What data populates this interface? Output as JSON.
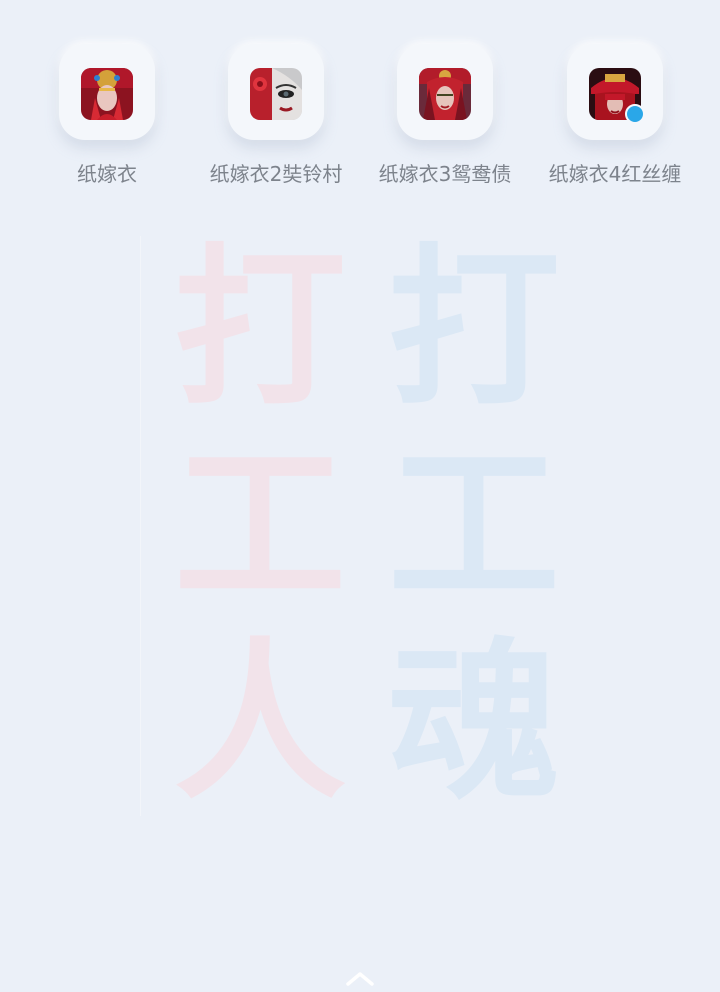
{
  "apps": [
    {
      "label": "纸嫁衣",
      "icon": "paper-bride-1-icon",
      "badge": false
    },
    {
      "label": "纸嫁衣2奘铃村",
      "icon": "paper-bride-2-icon",
      "badge": false
    },
    {
      "label": "纸嫁衣3鸳鸯债",
      "icon": "paper-bride-3-icon",
      "badge": false
    },
    {
      "label": "纸嫁衣4红丝缠",
      "icon": "paper-bride-4-icon",
      "badge": true
    }
  ],
  "wallpaper": {
    "left_column": [
      "打",
      "工",
      "人"
    ],
    "right_column": [
      "打",
      "工",
      "魂"
    ],
    "left_color": "#f2e3ea",
    "right_color": "#dbe8f5"
  },
  "colors": {
    "background": "#ebf0f8",
    "label": "#7d838c",
    "badge": "#2aa7e8"
  },
  "home_indicator": "chevron-up-icon"
}
